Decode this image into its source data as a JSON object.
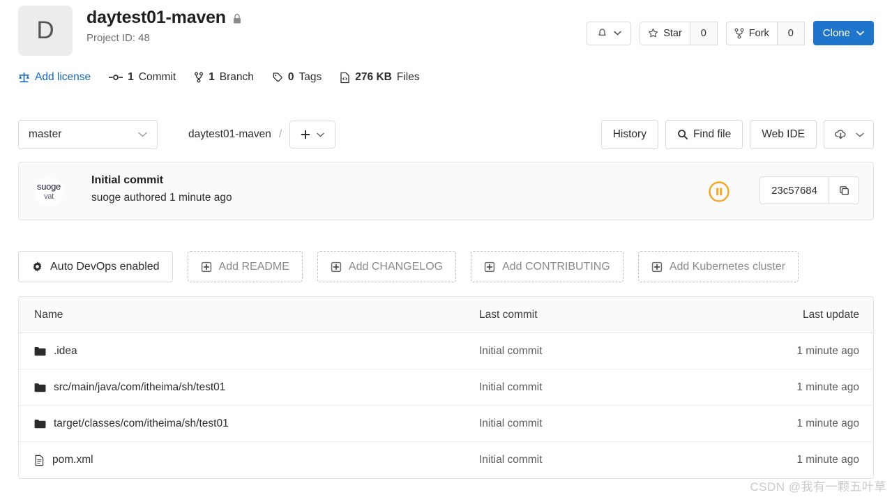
{
  "project": {
    "avatar_letter": "D",
    "name": "daytest01-maven",
    "visibility_icon": "lock-icon",
    "project_id_label": "Project ID: 48"
  },
  "header_actions": {
    "notification_icon": "bell-icon",
    "star_label": "Star",
    "star_count": "0",
    "fork_label": "Fork",
    "fork_count": "0",
    "clone_label": "Clone"
  },
  "stats": [
    {
      "icon": "scale-icon",
      "label": "Add license",
      "value": "",
      "link": true
    },
    {
      "icon": "commit-icon",
      "value": "1",
      "label": "Commit",
      "link": false
    },
    {
      "icon": "branch-icon",
      "value": "1",
      "label": "Branch",
      "link": false
    },
    {
      "icon": "tag-icon",
      "value": "0",
      "label": "Tags",
      "link": false
    },
    {
      "icon": "file-code-icon",
      "value": "276 KB",
      "label": "Files",
      "link": false
    }
  ],
  "toolbar": {
    "branch": "master",
    "breadcrumb_root": "daytest01-maven",
    "breadcrumb_separator": "/",
    "add_button_icon": "plus-icon",
    "history_label": "History",
    "find_file_label": "Find file",
    "find_file_icon": "search-icon",
    "web_ide_label": "Web IDE",
    "download_icon": "cloud-download-icon"
  },
  "commit": {
    "avatar_line1": "suoge",
    "avatar_line2": "vat",
    "title": "Initial commit",
    "subtitle": "suoge authored 1 minute ago",
    "pipeline_status_icon": "pipeline-pending-icon",
    "pipeline_status_color": "#f5a623",
    "sha": "23c57684",
    "copy_icon": "copy-icon"
  },
  "quick_actions": [
    {
      "icon": "gear-icon",
      "label": "Auto DevOps enabled",
      "style": "solid"
    },
    {
      "icon": "plus-square-icon",
      "label": "Add README",
      "style": "dashed"
    },
    {
      "icon": "plus-square-icon",
      "label": "Add CHANGELOG",
      "style": "dashed"
    },
    {
      "icon": "plus-square-icon",
      "label": "Add CONTRIBUTING",
      "style": "dashed"
    },
    {
      "icon": "plus-square-icon",
      "label": "Add Kubernetes cluster",
      "style": "dashed"
    }
  ],
  "file_table": {
    "columns": {
      "name": "Name",
      "last_commit": "Last commit",
      "last_update": "Last update"
    },
    "rows": [
      {
        "icon": "folder-icon",
        "name": ".idea",
        "last_commit": "Initial commit",
        "last_update": "1 minute ago"
      },
      {
        "icon": "folder-icon",
        "name": "src/main/java/com/itheima/sh/test01",
        "last_commit": "Initial commit",
        "last_update": "1 minute ago"
      },
      {
        "icon": "folder-icon",
        "name": "target/classes/com/itheima/sh/test01",
        "last_commit": "Initial commit",
        "last_update": "1 minute ago"
      },
      {
        "icon": "file-icon",
        "name": "pom.xml",
        "last_commit": "Initial commit",
        "last_update": "1 minute ago"
      }
    ]
  },
  "watermark": {
    "text": "CSDN @我有一颗五叶草"
  },
  "colors": {
    "primary": "#1f75cb",
    "link": "#1068bf",
    "pipeline": "#f5a623"
  }
}
